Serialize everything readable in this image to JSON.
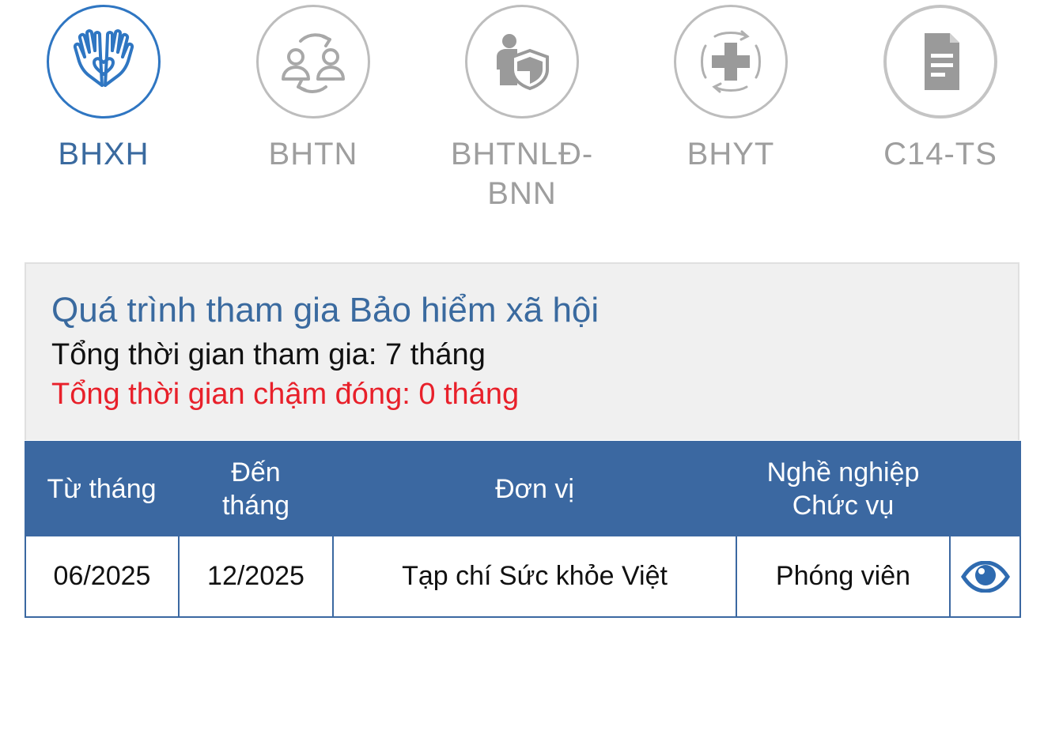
{
  "tabs": [
    {
      "label": "BHXH",
      "icon": "hands-heart-icon",
      "active": true
    },
    {
      "label": "BHTN",
      "icon": "people-exchange-icon",
      "active": false
    },
    {
      "label": "BHTNLĐ-BNN",
      "icon": "worker-shield-icon",
      "active": false
    },
    {
      "label": "BHYT",
      "icon": "medical-cross-icon",
      "active": false
    },
    {
      "label": "C14-TS",
      "icon": "document-icon",
      "active": false
    }
  ],
  "summary": {
    "title": "Quá trình tham gia Bảo hiểm xã hội",
    "total": "Tổng thời gian tham gia: 7 tháng",
    "late": "Tổng thời gian chậm đóng: 0 tháng"
  },
  "table": {
    "headers": {
      "from": "Từ tháng",
      "to_line1": "Đến",
      "to_line2": "tháng",
      "unit": "Đơn vị",
      "job_line1": "Nghề nghiệp",
      "job_line2": "Chức vụ"
    },
    "rows": [
      {
        "from": "06/2025",
        "to": "12/2025",
        "unit": "Tạp chí Sức khỏe Việt",
        "job": "Phóng viên"
      }
    ]
  },
  "colors": {
    "accent": "#2f76c2",
    "header_bg": "#3b68a1",
    "late_text": "#e8202a",
    "inactive": "#9e9e9e"
  }
}
